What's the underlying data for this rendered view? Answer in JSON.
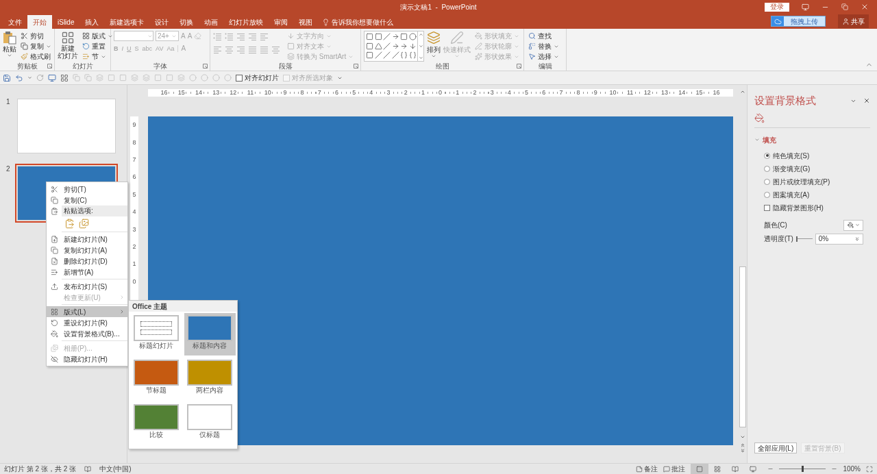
{
  "title_bar": {
    "title": "演示文稿1  -  PowerPoint",
    "login_button": "登录"
  },
  "tabs": [
    {
      "label": "文件",
      "selected": false
    },
    {
      "label": "开始",
      "selected": true
    },
    {
      "label": "iSlide",
      "selected": false
    },
    {
      "label": "插入",
      "selected": false
    },
    {
      "label": "新建选项卡",
      "selected": false
    },
    {
      "label": "设计",
      "selected": false
    },
    {
      "label": "切换",
      "selected": false
    },
    {
      "label": "动画",
      "selected": false
    },
    {
      "label": "幻灯片放映",
      "selected": false
    },
    {
      "label": "审阅",
      "selected": false
    },
    {
      "label": "视图",
      "selected": false
    }
  ],
  "tell_me": "告诉我你想要做什么",
  "upload_button": "拖拽上传",
  "share_button": "共享",
  "ribbon": {
    "clipboard": {
      "label": "剪贴板",
      "paste": "粘贴",
      "cut": "剪切",
      "copy": "复制",
      "format_painter": "格式刷"
    },
    "slides": {
      "label": "幻灯片",
      "new_slide": [
        "新建",
        "幻灯片"
      ],
      "layout": "版式",
      "reset": "重置",
      "section": "节"
    },
    "font": {
      "label": "字体",
      "disabled": true,
      "font_size": "24+",
      "size_buttons": [
        "A",
        "A"
      ],
      "format_buttons": [
        "B",
        "I",
        "U",
        "S",
        "abc"
      ],
      "spacing": "AV",
      "change_case": "Aa",
      "font_color": "A"
    },
    "paragraph": {
      "label": "段落",
      "disabled": true,
      "text_direction": "文字方向",
      "align_text": "对齐文本",
      "smartart": "转换为 SmartArt"
    },
    "drawing": {
      "label": "绘图",
      "arrange": "排列",
      "quick_styles": {
        "label": "快速样式",
        "disabled": true
      },
      "shape_options": [
        {
          "label": "形状填充",
          "disabled": true
        },
        {
          "label": "形状轮廓",
          "disabled": true
        },
        {
          "label": "形状效果",
          "disabled": true
        }
      ]
    },
    "editing": {
      "label": "编辑",
      "items": [
        {
          "label": "查找",
          "caret": false
        },
        {
          "label": "替换",
          "caret": true
        },
        {
          "label": "选择",
          "caret": true
        }
      ]
    }
  },
  "quick_access": {
    "checkboxes": [
      {
        "label": "对齐幻灯片",
        "checked": false,
        "disabled": false
      },
      {
        "label": "对齐所选对象",
        "checked": false,
        "disabled": true
      }
    ]
  },
  "horizontal_ruler": [
    "16",
    "15",
    "14",
    "13",
    "12",
    "11",
    "10",
    "9",
    "8",
    "7",
    "6",
    "5",
    "4",
    "3",
    "2",
    "1",
    "0",
    "1",
    "2",
    "3",
    "4",
    "5",
    "6",
    "7",
    "8",
    "9",
    "10",
    "11",
    "12",
    "13",
    "14",
    "15",
    "16"
  ],
  "vertical_ruler": [
    "9",
    "8",
    "7",
    "6",
    "5",
    "4",
    "3",
    "2",
    "1",
    "0"
  ],
  "thumbnails": [
    {
      "number": "1",
      "color": "#ffffff",
      "selected": false
    },
    {
      "number": "2",
      "color": "#2e75b6",
      "selected": true
    }
  ],
  "context_menu": [
    {
      "kind": "item",
      "label": "剪切(T)",
      "disabled": false,
      "selected": false,
      "submenu": false
    },
    {
      "kind": "item",
      "label": "复制(C)",
      "disabled": false,
      "selected": false,
      "submenu": false
    },
    {
      "kind": "header",
      "label": "粘贴选项:"
    },
    {
      "kind": "paste_options"
    },
    {
      "kind": "separator"
    },
    {
      "kind": "item",
      "label": "新建幻灯片(N)",
      "disabled": false,
      "selected": false,
      "submenu": false
    },
    {
      "kind": "item",
      "label": "复制幻灯片(A)",
      "disabled": false,
      "selected": false,
      "submenu": false
    },
    {
      "kind": "item",
      "label": "删除幻灯片(D)",
      "disabled": false,
      "selected": false,
      "submenu": false
    },
    {
      "kind": "item",
      "label": "新增节(A)",
      "disabled": false,
      "selected": false,
      "submenu": false
    },
    {
      "kind": "separator"
    },
    {
      "kind": "item",
      "label": "发布幻灯片(S)",
      "disabled": false,
      "selected": false,
      "submenu": false
    },
    {
      "kind": "item",
      "label": "检查更新(U)",
      "disabled": true,
      "selected": false,
      "submenu": true
    },
    {
      "kind": "separator"
    },
    {
      "kind": "item",
      "label": "版式(L)",
      "disabled": false,
      "selected": true,
      "submenu": true
    },
    {
      "kind": "item",
      "label": "重设幻灯片(R)",
      "disabled": false,
      "selected": false,
      "submenu": false
    },
    {
      "kind": "item",
      "label": "设置背景格式(B)...",
      "disabled": false,
      "selected": false,
      "submenu": false
    },
    {
      "kind": "separator"
    },
    {
      "kind": "item",
      "label": "相册(P)...",
      "disabled": true,
      "selected": false,
      "submenu": false
    },
    {
      "kind": "item",
      "label": "隐藏幻灯片(H)",
      "disabled": false,
      "selected": false,
      "submenu": false
    }
  ],
  "layout_gallery": {
    "title": "Office 主题",
    "layouts": [
      {
        "label": "标题幻灯片",
        "kind": "placeholder",
        "color": "#ffffff",
        "selected": false
      },
      {
        "label": "标题和内容",
        "kind": "plain",
        "color": "#2e75b6",
        "selected": true
      },
      {
        "label": "节标题",
        "kind": "plain",
        "color": "#c55a11",
        "selected": false
      },
      {
        "label": "两栏内容",
        "kind": "plain",
        "color": "#bf9000",
        "selected": false
      },
      {
        "label": "比较",
        "kind": "plain",
        "color": "#538135",
        "selected": false
      },
      {
        "label": "仅标题",
        "kind": "plain",
        "color": "#ffffff",
        "selected": false
      }
    ]
  },
  "format_pane": {
    "title": "设置背景格式",
    "section": {
      "label": "填充",
      "expanded": true
    },
    "fill_options": [
      {
        "label": "纯色填充(S)",
        "selected": true
      },
      {
        "label": "渐变填充(G)",
        "selected": false
      },
      {
        "label": "图片或纹理填充(P)",
        "selected": false
      },
      {
        "label": "图案填充(A)",
        "selected": false
      }
    ],
    "hide_graphics": {
      "label": "隐藏背景图形(H)",
      "checked": false
    },
    "color_label": "颜色(C)",
    "transparency": {
      "label": "透明度(T)",
      "level": 0,
      "value": "0%"
    },
    "apply_all": "全部应用(L)",
    "reset": {
      "label": "重置背景(B)",
      "disabled": true
    }
  },
  "status_bar": {
    "slide_info": "幻灯片 第 2 张，共 2 张",
    "language": "中文(中国)",
    "notes": "备注",
    "comments": "批注",
    "views": [
      {
        "selected": true
      },
      {
        "selected": false
      },
      {
        "selected": false
      },
      {
        "selected": false
      }
    ],
    "zoom": {
      "level": 0.5,
      "value": "100%"
    }
  }
}
